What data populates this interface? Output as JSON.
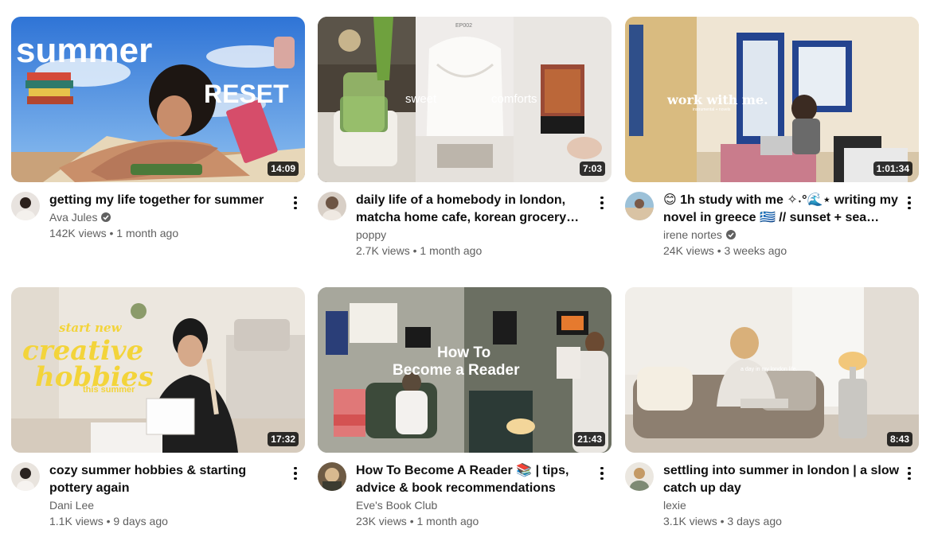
{
  "videos": [
    {
      "title": "getting my life together for summer",
      "channel": "Ava Jules",
      "verified": true,
      "views": "142K views",
      "age": "1 month ago",
      "duration": "14:09",
      "overlay_lines": [
        "summer",
        "RESET"
      ]
    },
    {
      "title": "daily life of a homebody in london, matcha home cafe, korean grocery haul…",
      "channel": "poppy",
      "verified": false,
      "views": "2.7K views",
      "age": "1 month ago",
      "duration": "7:03",
      "overlay_lines": [
        "sweet",
        "comforts",
        "EP002"
      ]
    },
    {
      "title": "😊 1h study with me ✧˖°🌊⋆ writing my novel in greece 🇬🇷 // sunset + sea soun…",
      "channel": "irene nortes",
      "verified": true,
      "views": "24K views",
      "age": "3 weeks ago",
      "duration": "1:01:34",
      "overlay_lines": [
        "work with me.",
        "instrumental + novels"
      ]
    },
    {
      "title": "cozy summer hobbies & starting pottery again",
      "channel": "Dani Lee",
      "verified": false,
      "views": "1.1K views",
      "age": "9 days ago",
      "duration": "17:32",
      "overlay_lines": [
        "start new",
        "creative",
        "hobbies",
        "this summer"
      ]
    },
    {
      "title": "How To Become A Reader 📚 | tips, advice & book recommendations",
      "channel": "Eve's Book Club",
      "verified": false,
      "views": "23K views",
      "age": "1 month ago",
      "duration": "21:43",
      "overlay_lines": [
        "How To",
        "Become a Reader"
      ]
    },
    {
      "title": "settling into summer in london | a slow catch up day",
      "channel": "lexie",
      "verified": false,
      "views": "3.1K views",
      "age": "3 days ago",
      "duration": "8:43",
      "overlay_lines": [
        "a day in my london life."
      ]
    }
  ],
  "separator": "•",
  "icons": {
    "verified": "verified-check-icon",
    "more": "more-vert-icon"
  }
}
